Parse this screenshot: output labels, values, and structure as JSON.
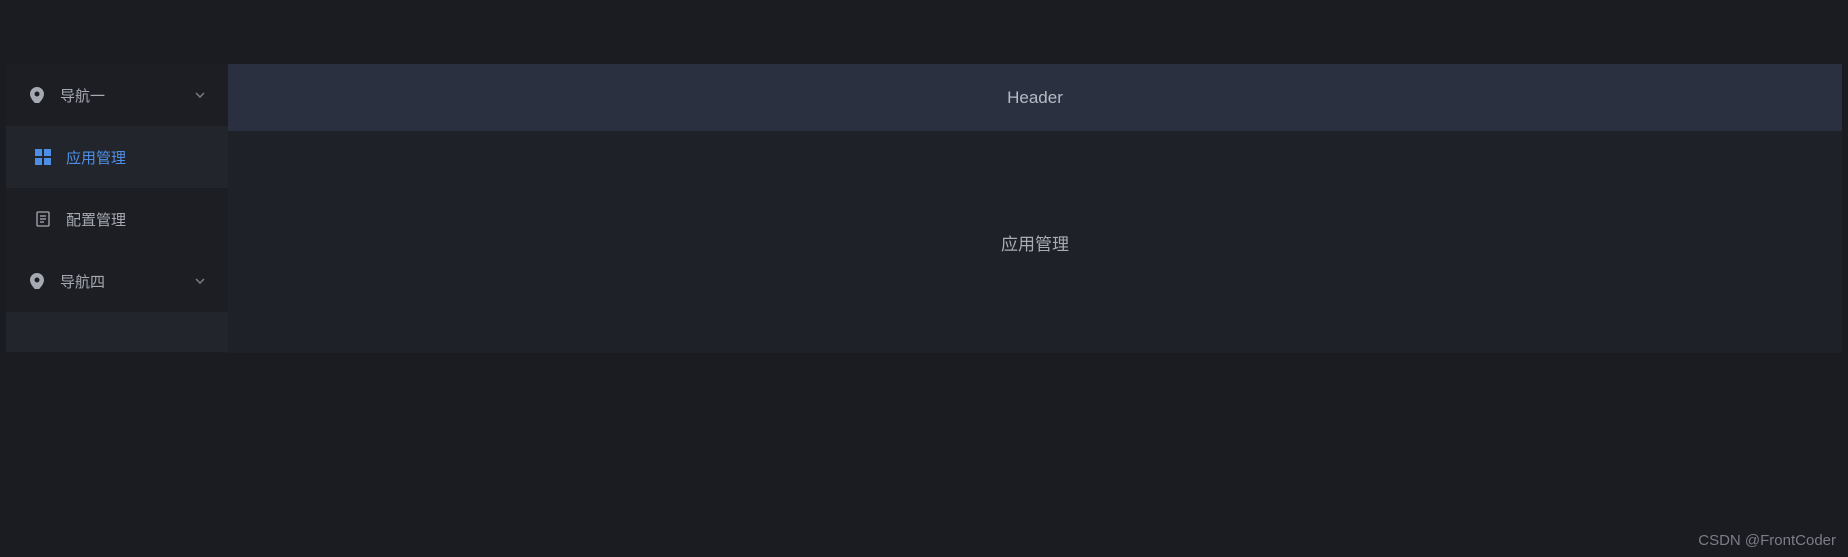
{
  "sidebar": {
    "items": [
      {
        "label": "导航一",
        "icon": "location"
      },
      {
        "label": "应用管理",
        "icon": "grid"
      },
      {
        "label": "配置管理",
        "icon": "document"
      },
      {
        "label": "导航四",
        "icon": "location"
      }
    ]
  },
  "header": {
    "title": "Header"
  },
  "content": {
    "title": "应用管理"
  },
  "watermark": "CSDN @FrontCoder"
}
